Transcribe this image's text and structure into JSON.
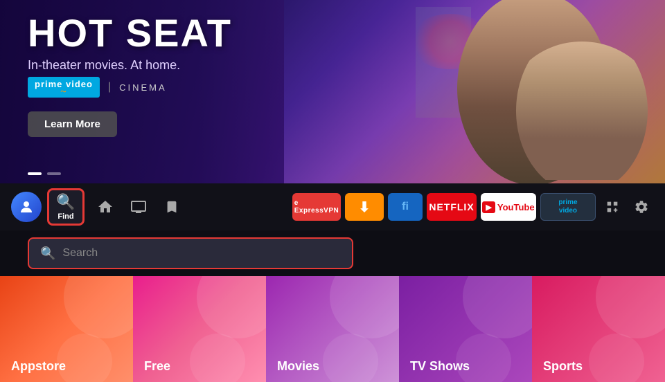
{
  "hero": {
    "title": "HOT SEAT",
    "subtitle": "In-theater movies. At home.",
    "brand": "prime video",
    "divider": "|",
    "cinema": "CINEMA",
    "learn_more": "Learn More",
    "dots": [
      true,
      false
    ]
  },
  "nav": {
    "find_label": "Find",
    "icons": [
      {
        "name": "home-icon",
        "symbol": "⌂"
      },
      {
        "name": "tv-icon",
        "symbol": "📺"
      },
      {
        "name": "bookmark-icon",
        "symbol": "🔖"
      }
    ],
    "apps": [
      {
        "name": "expressvpn",
        "label": "ExpressVPN"
      },
      {
        "name": "downloader",
        "label": "⬇"
      },
      {
        "name": "blue-app",
        "label": "fi"
      },
      {
        "name": "netflix",
        "label": "NETFLIX"
      },
      {
        "name": "youtube",
        "label": "YouTube"
      },
      {
        "name": "prime-video",
        "label": "prime video"
      }
    ]
  },
  "search": {
    "placeholder": "Search"
  },
  "categories": [
    {
      "name": "Appstore",
      "class": "cat-appstore"
    },
    {
      "name": "Free",
      "class": "cat-free"
    },
    {
      "name": "Movies",
      "class": "cat-movies"
    },
    {
      "name": "TV Shows",
      "class": "cat-tvshows"
    },
    {
      "name": "Sports",
      "class": "cat-sports"
    }
  ]
}
